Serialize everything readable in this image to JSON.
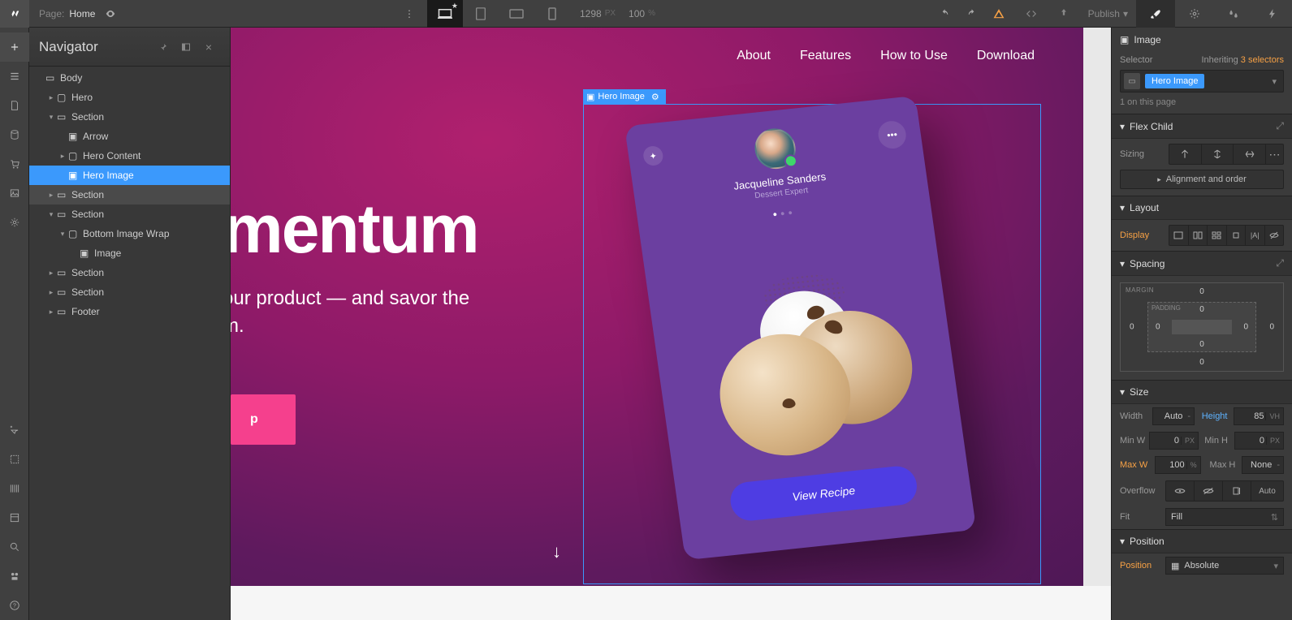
{
  "topbar": {
    "page_label": "Page:",
    "page_name": "Home",
    "canvas_width": "1298",
    "width_unit": "PX",
    "zoom": "100",
    "zoom_unit": "%",
    "publish_label": "Publish"
  },
  "navigator": {
    "title": "Navigator",
    "tree": {
      "body": "Body",
      "hero": "Hero",
      "section1": "Section",
      "arrow": "Arrow",
      "hero_content": "Hero Content",
      "hero_image": "Hero Image",
      "section2": "Section",
      "section3": "Section",
      "bottom_image_wrap": "Bottom Image Wrap",
      "image": "Image",
      "section4": "Section",
      "section5": "Section",
      "footer": "Footer"
    }
  },
  "canvas": {
    "nav": {
      "about": "About",
      "features": "Features",
      "how": "How to Use",
      "download": "Download"
    },
    "selection_label": "Hero Image",
    "headline": "mentum",
    "subline": "our product — and savor the",
    "subline2": "m.",
    "button": "p",
    "phone": {
      "name": "Jacqueline Sanders",
      "role": "Dessert Expert",
      "cta": "View Recipe"
    }
  },
  "inspector": {
    "element_type": "Image",
    "selector_label": "Selector",
    "inheriting_prefix": "Inheriting",
    "inheriting_count": "3 selectors",
    "selector_tag": "Hero Image",
    "count_text": "1 on this page",
    "flex_child": {
      "title": "Flex Child",
      "sizing_label": "Sizing",
      "align_order": "Alignment and order"
    },
    "layout": {
      "title": "Layout",
      "display_label": "Display"
    },
    "spacing": {
      "title": "Spacing",
      "margin_label": "MARGIN",
      "padding_label": "PADDING",
      "m_top": "0",
      "m_right": "0",
      "m_bottom": "0",
      "m_left": "0",
      "p_top": "0",
      "p_right": "0",
      "p_bottom": "0",
      "p_left": "0"
    },
    "size": {
      "title": "Size",
      "width_label": "Width",
      "width_value": "Auto",
      "height_label": "Height",
      "height_value": "85",
      "height_unit": "VH",
      "minw_label": "Min W",
      "minw_value": "0",
      "minw_unit": "PX",
      "minh_label": "Min H",
      "minh_value": "0",
      "minh_unit": "PX",
      "maxw_label": "Max W",
      "maxw_value": "100",
      "maxw_unit": "%",
      "maxh_label": "Max H",
      "maxh_value": "None",
      "overflow_label": "Overflow",
      "overflow_auto": "Auto",
      "fit_label": "Fit",
      "fit_value": "Fill"
    },
    "position": {
      "title": "Position",
      "label": "Position",
      "value": "Absolute"
    }
  }
}
